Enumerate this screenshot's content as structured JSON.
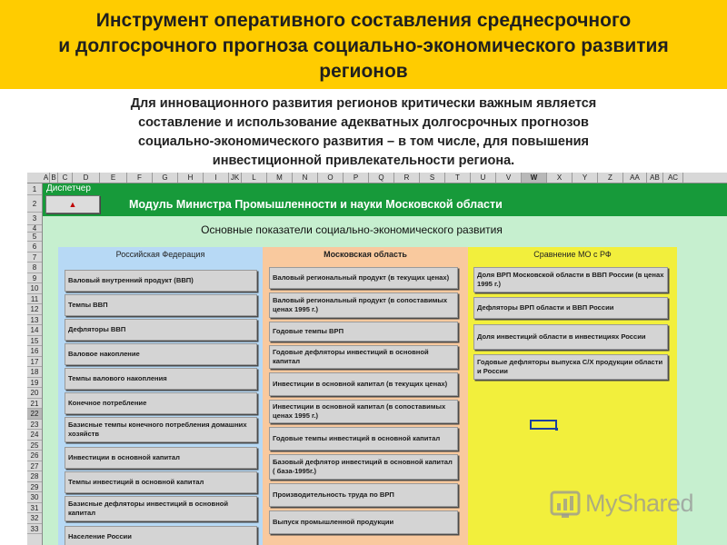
{
  "slide": {
    "title_lines": [
      "Инструмент оперативного составления среднесрочного",
      "и долгосрочного прогноза социально-экономического развития",
      "регионов"
    ],
    "intro_lines": [
      "Для инновационного развития регионов критически важным является",
      "составление и использование адекватных долгосрочных прогнозов",
      "социально-экономического развития – в том числе, для повышения",
      "инвестиционной привлекательности региона."
    ]
  },
  "sheet": {
    "columns": [
      "A",
      "B",
      "C",
      "D",
      "E",
      "F",
      "G",
      "H",
      "I",
      "JK",
      "L",
      "M",
      "N",
      "O",
      "P",
      "Q",
      "R",
      "S",
      "T",
      "U",
      "V",
      "W",
      "X",
      "Y",
      "Z",
      "AA",
      "AB",
      "AC"
    ],
    "selected_column": "W",
    "rows": [
      "1",
      "2",
      "3",
      "4",
      "5",
      "6",
      "7",
      "8",
      "9",
      "10",
      "11",
      "12",
      "13",
      "14",
      "15",
      "16",
      "17",
      "18",
      "19",
      "20",
      "21",
      "22",
      "23",
      "24",
      "25",
      "26",
      "27",
      "28",
      "29",
      "30",
      "31",
      "32",
      "33"
    ],
    "selected_row": "22",
    "dispatcher_label": "Диспетчер",
    "back_button_label": "▲",
    "module_title": "Модуль Министра Промышленности и науки Московской области",
    "subtitle": "Основные показатели социально-экономического развития",
    "panels": {
      "rf": {
        "title": "Российская Федерация",
        "buttons": [
          "Валовый внутренний продукт (ВВП)",
          "Темпы ВВП",
          "Дефляторы ВВП",
          "Валовое накопление",
          "Темпы валового накопления",
          "Конечное потребление",
          "Базисные темпы конечного потребления домашних хозяйств",
          "Инвестиции в основной капитал",
          "Темпы инвестиций в основной капитал",
          "Базисные дефляторы инвестиций в основной капитал",
          "Население России"
        ]
      },
      "mo": {
        "title": "Московская область",
        "buttons": [
          "Валовый региональный продукт (в текущих ценах)",
          "Валовый региональный продукт (в сопоставимых ценах 1995 г.)",
          "Годовые темпы ВРП",
          "Годовые дефляторы инвестиций в основной капитал",
          "Инвестиции в основной капитал (в текущих ценах)",
          "Инвестиции в основной капитал (в сопоставимых ценах 1995 г.)",
          "Годовые темпы инвестиций в основной капитал",
          "Базовый дефлятор инвестиций в основной капитал ( база-1995г.)",
          "Производительность труда по ВРП",
          "Выпуск промышленной продукции"
        ]
      },
      "cmp": {
        "title": "Сравнение МО с РФ",
        "buttons": [
          "Доля ВРП Московской области в ВВП России (в ценах 1995 г.)",
          "Дефляторы ВРП области и ВВП России",
          "Доля инвестиций области в инвестициях России",
          "Годовые дефляторы выпуска С/Х продукции области и России"
        ]
      }
    },
    "colors": {
      "green_band": "#179a3a",
      "sheet_bg": "#c6efcf",
      "rf_panel": "#b7d9f5",
      "mo_panel": "#f9c99e",
      "cmp_panel": "#f2ef3c",
      "header_bg": "#ffcc00"
    }
  },
  "watermark": {
    "text": "MyShared",
    "icon": "bar-chart-icon"
  }
}
